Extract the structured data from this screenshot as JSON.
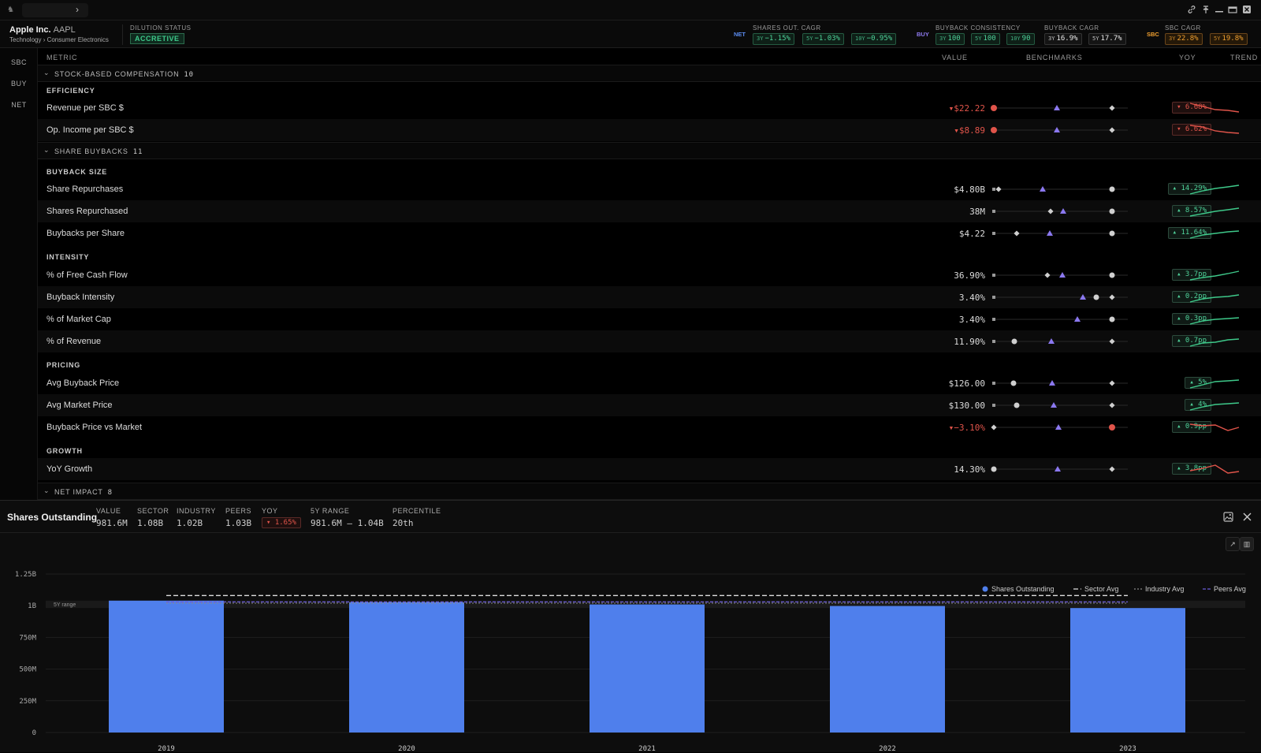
{
  "header": {
    "company": "Apple Inc.",
    "ticker": "AAPL",
    "sector_path": "Technology › Consumer Electronics",
    "dilution_label": "DILUTION STATUS",
    "dilution_status": "ACCRETIVE",
    "groups": {
      "net": "NET",
      "buy": "BUY",
      "sbc": "SBC"
    },
    "shares_cagr": {
      "label": "SHARES OUT. CAGR",
      "pills": [
        {
          "period": "3Y",
          "value": "−1.15%"
        },
        {
          "period": "5Y",
          "value": "−1.03%"
        },
        {
          "period": "10Y",
          "value": "−0.95%"
        }
      ]
    },
    "buyback_consistency": {
      "label": "BUYBACK CONSISTENCY",
      "pills": [
        {
          "period": "3Y",
          "value": "100"
        },
        {
          "period": "5Y",
          "value": "100"
        },
        {
          "period": "10Y",
          "value": "90"
        }
      ]
    },
    "buyback_cagr": {
      "label": "BUYBACK CAGR",
      "pills": [
        {
          "period": "3Y",
          "value": "16.9%"
        },
        {
          "period": "5Y",
          "value": "17.7%"
        }
      ]
    },
    "sbc_cagr": {
      "label": "SBC CAGR",
      "pills": [
        {
          "period": "3Y",
          "value": "22.8%"
        },
        {
          "period": "5Y",
          "value": "19.8%"
        }
      ]
    }
  },
  "sidenav": [
    "SBC",
    "BUY",
    "NET"
  ],
  "columns": {
    "metric": "METRIC",
    "value": "VALUE",
    "benchmarks": "BENCHMARKS",
    "yoy": "YOY",
    "trend": "TREND"
  },
  "sections": {
    "sbc": {
      "label": "STOCK-BASED COMPENSATION",
      "count": "10"
    },
    "buybacks": {
      "label": "SHARE BUYBACKS",
      "count": "11"
    },
    "net": {
      "label": "NET IMPACT",
      "count": "8"
    }
  },
  "subsections": {
    "efficiency": "EFFICIENCY",
    "size": "BUYBACK SIZE",
    "intensity": "INTENSITY",
    "pricing": "PRICING",
    "growth": "GROWTH"
  },
  "rows": {
    "rev_sbc": {
      "name": "Revenue per SBC $",
      "value": "$22.22",
      "yoy": "6.68%"
    },
    "op_sbc": {
      "name": "Op. Income per SBC $",
      "value": "$8.89",
      "yoy": "6.62%"
    },
    "repurch": {
      "name": "Share Repurchases",
      "value": "$4.80B",
      "yoy": "14.29%"
    },
    "shares_rep": {
      "name": "Shares Repurchased",
      "value": "38M",
      "yoy": "8.57%"
    },
    "bps": {
      "name": "Buybacks per Share",
      "value": "$4.22",
      "yoy": "11.64%"
    },
    "fcf": {
      "name": "% of Free Cash Flow",
      "value": "36.90%",
      "yoy": "3.7pp"
    },
    "intensity": {
      "name": "Buyback Intensity",
      "value": "3.40%",
      "yoy": "0.2pp"
    },
    "mcap": {
      "name": "% of Market Cap",
      "value": "3.40%",
      "yoy": "0.3pp"
    },
    "revenue": {
      "name": "% of Revenue",
      "value": "11.90%",
      "yoy": "0.7pp"
    },
    "avg_bb": {
      "name": "Avg Buyback Price",
      "value": "$126.00",
      "yoy": "5%"
    },
    "avg_mkt": {
      "name": "Avg Market Price",
      "value": "$130.00",
      "yoy": "4%"
    },
    "bb_vs_mkt": {
      "name": "Buyback Price vs Market",
      "value": "−3.10%",
      "yoy": "0.9pp"
    },
    "yoy_growth": {
      "name": "YoY Growth",
      "value": "14.30%",
      "yoy": "3.8pp"
    }
  },
  "panel": {
    "title": "Shares Outstanding",
    "stats": {
      "value_label": "VALUE",
      "value": "981.6M",
      "sector_label": "SECTOR",
      "sector": "1.08B",
      "industry_label": "INDUSTRY",
      "industry": "1.02B",
      "peers_label": "PEERS",
      "peers": "1.03B",
      "yoy_label": "YOY",
      "yoy": "1.65%",
      "range_label": "5Y RANGE",
      "range": "981.6M — 1.04B",
      "pct_label": "PERCENTILE",
      "pct": "20th"
    }
  },
  "chart_data": {
    "type": "bar",
    "categories": [
      "2019",
      "2020",
      "2021",
      "2022",
      "2023"
    ],
    "series": [
      {
        "name": "Shares Outstanding",
        "values": [
          1.04,
          1.027,
          1.01,
          0.998,
          0.9816
        ]
      }
    ],
    "benchmarks": [
      {
        "name": "Sector Avg",
        "value": 1.08
      },
      {
        "name": "Industry Avg",
        "value": 1.02
      },
      {
        "name": "Peers Avg",
        "value": 1.03
      }
    ],
    "range_band": {
      "label": "5Y range",
      "low": 0.9816,
      "high": 1.04
    },
    "yticks": [
      "0",
      "250M",
      "500M",
      "750M",
      "1B",
      "1.25B"
    ],
    "ylim": [
      0,
      1.25
    ],
    "unit": "B",
    "grid": true,
    "legend": "top-right",
    "colors": {
      "bar": "#4f7fec",
      "sector": "#dddddd",
      "industry": "#888888",
      "peers": "#6a5bd8"
    }
  }
}
